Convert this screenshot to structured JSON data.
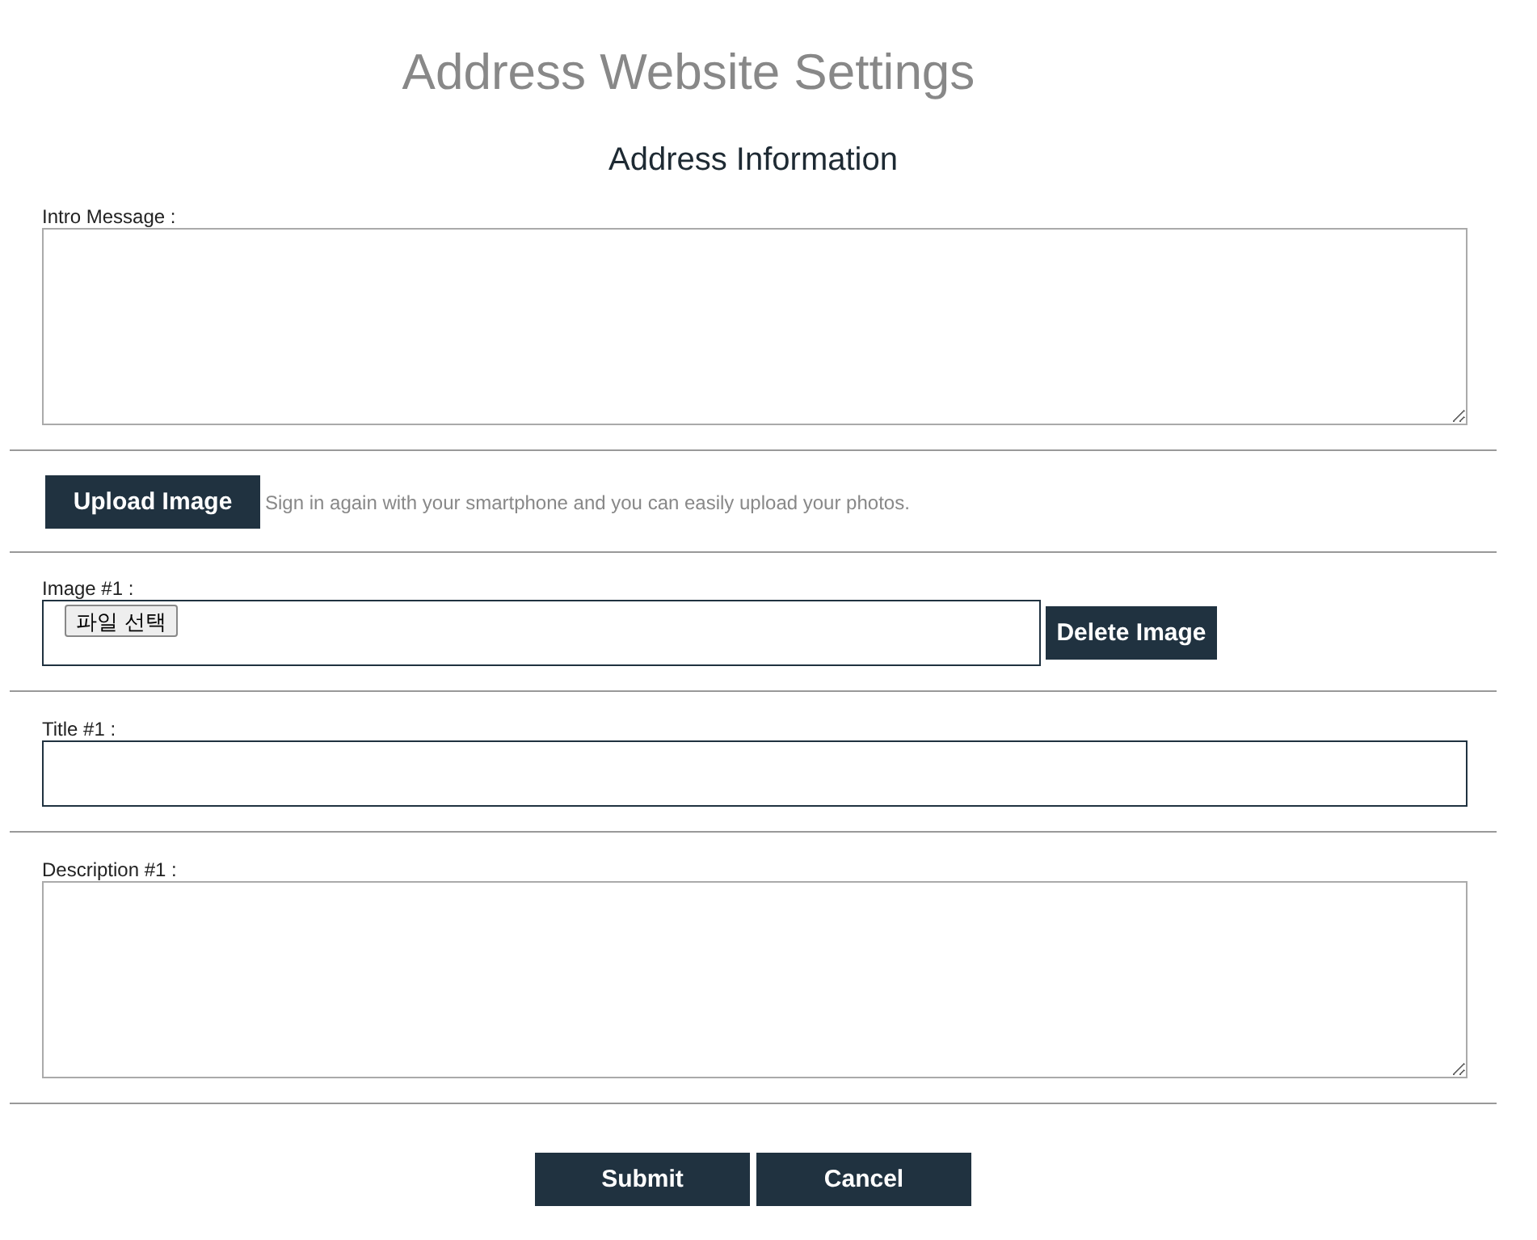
{
  "page_title": "Address Website Settings",
  "section_title": "Address Information",
  "intro": {
    "label": "Intro Message :"
  },
  "upload": {
    "button": "Upload Image",
    "hint": "Sign in again with your smartphone and you can easily upload your photos."
  },
  "image": {
    "label": "Image #1 :",
    "file_button": "파일 선택",
    "delete_button": "Delete Image"
  },
  "title_field": {
    "label": "Title #1 :"
  },
  "description": {
    "label": "Description #1 :"
  },
  "buttons": [
    "Submit",
    "Cancel"
  ]
}
